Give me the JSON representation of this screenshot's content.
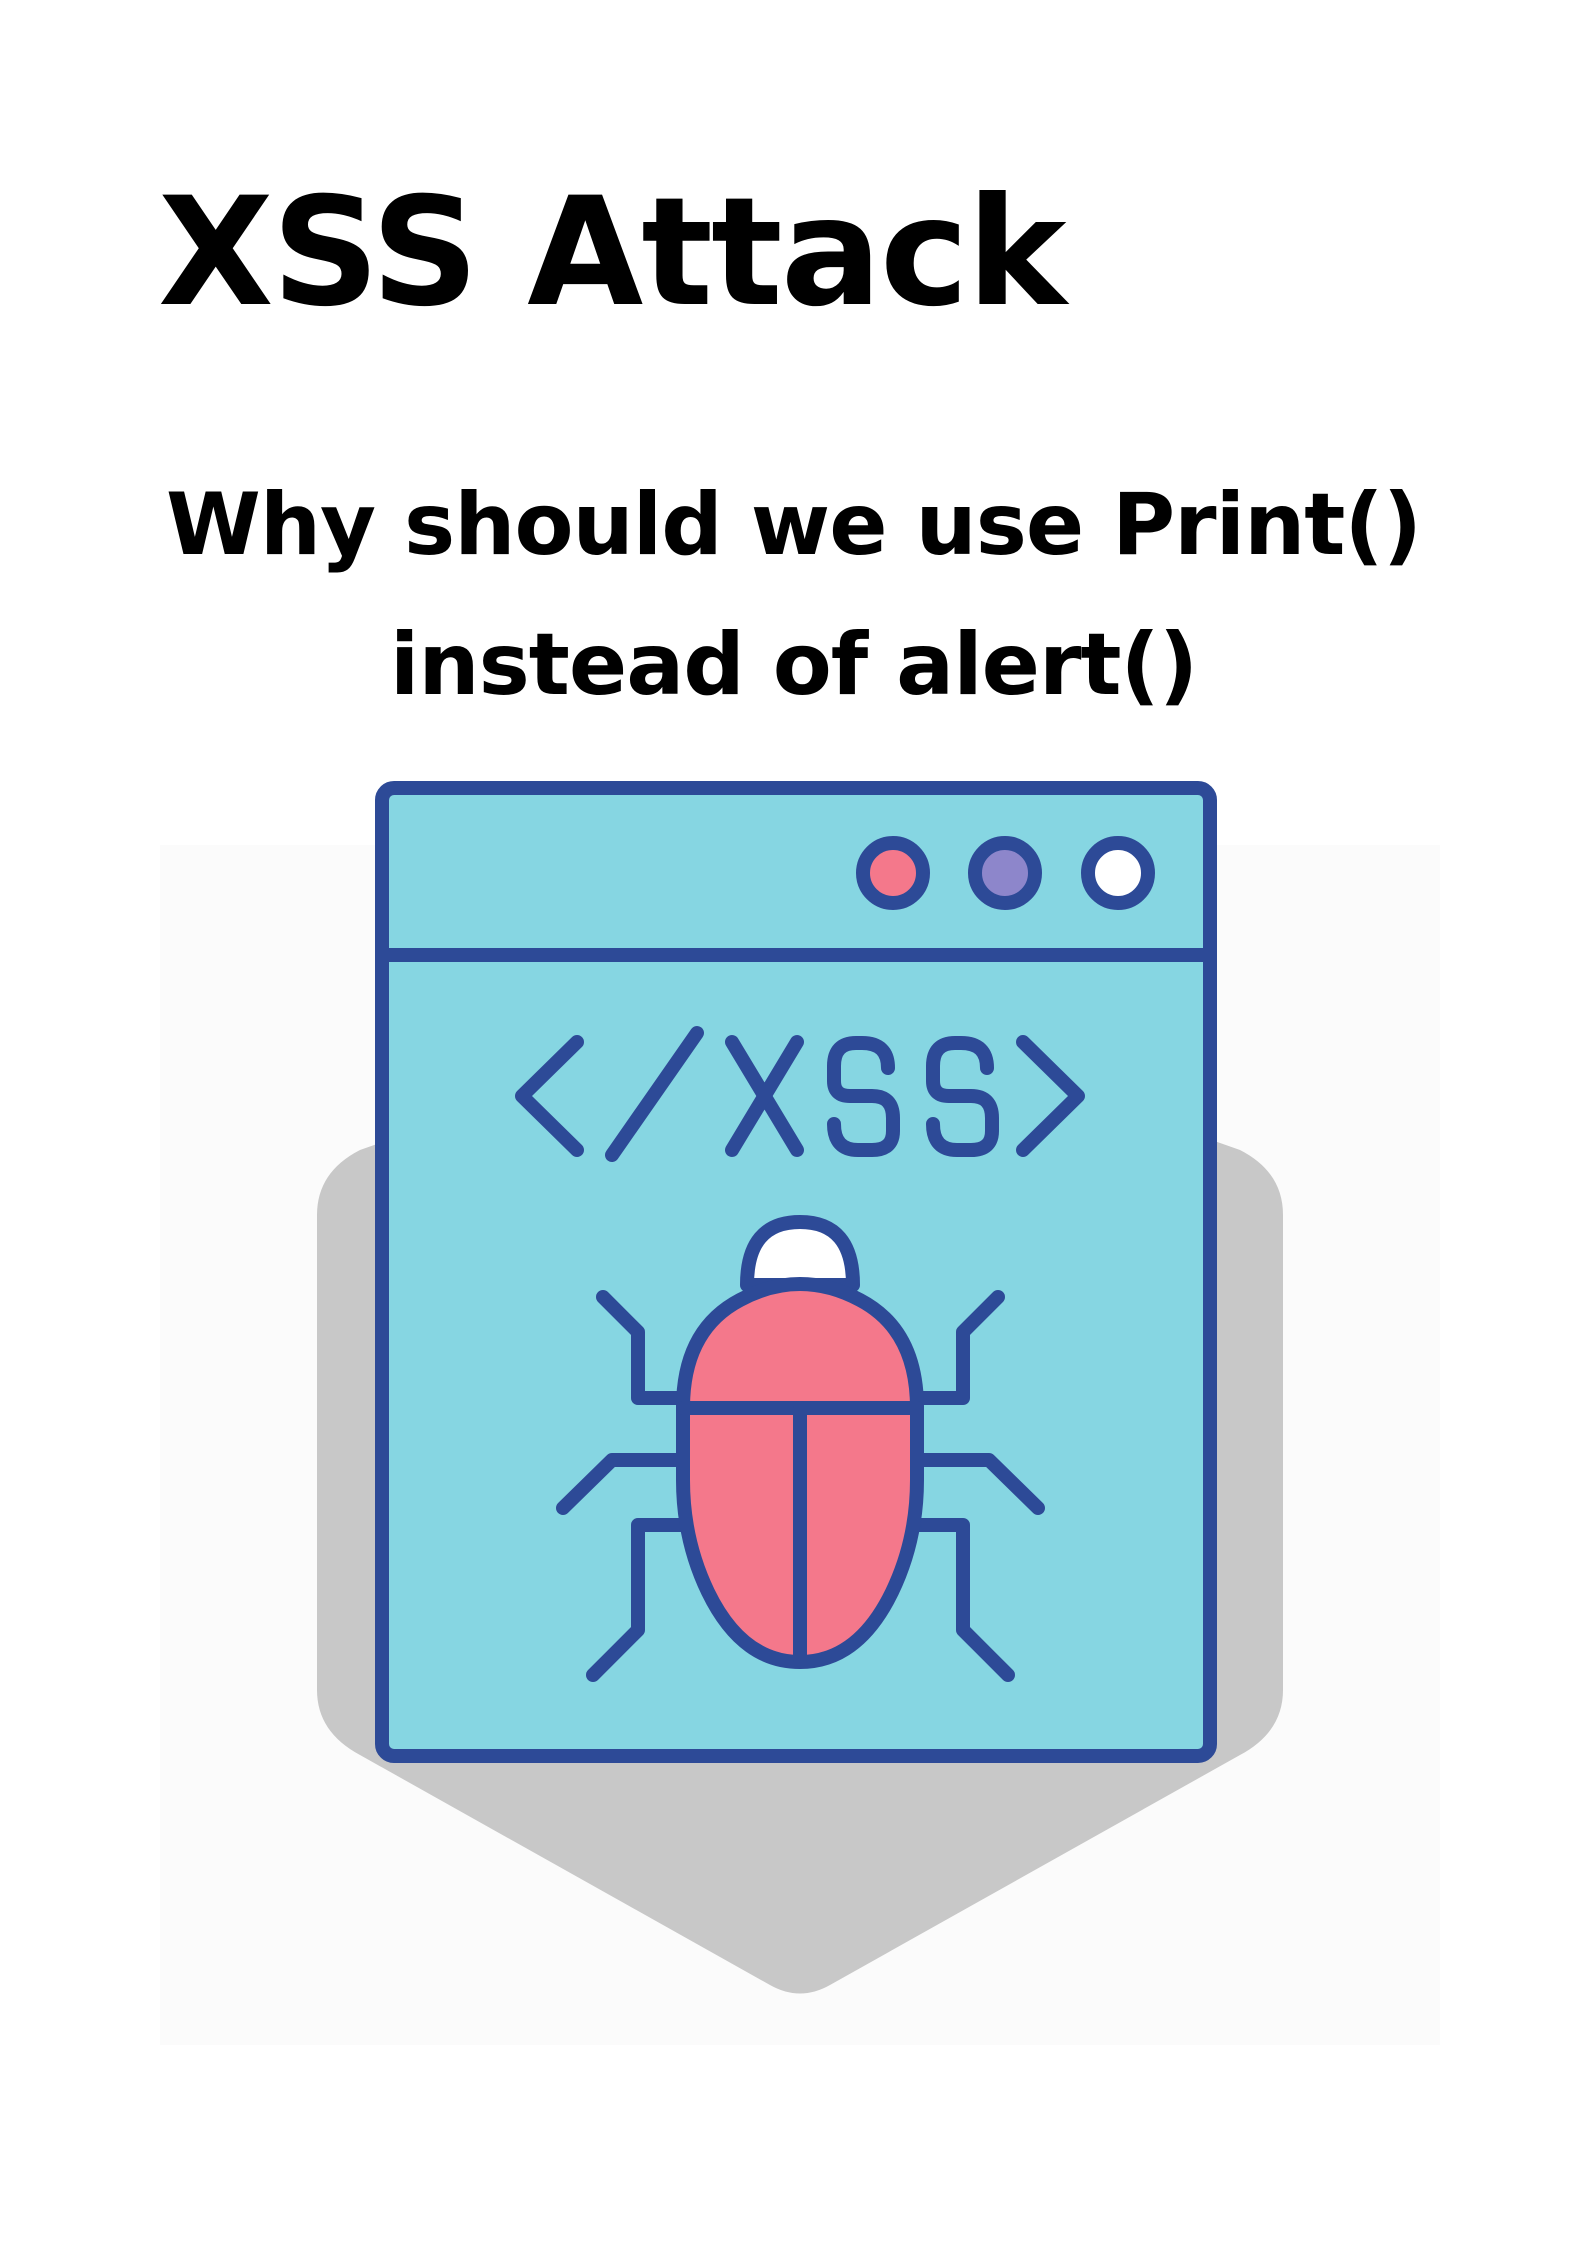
{
  "title": "XSS Attack",
  "subtitle": {
    "line1": "Why should we use Print()",
    "line2": "instead of alert()"
  },
  "illustration": {
    "code_text": "</XSS>",
    "icon": "browser-window-bug-icon",
    "colors": {
      "window_fill": "#86D6E2",
      "outline": "#2D4A97",
      "bug_body": "#F4788B",
      "bug_head": "#FFFFFF",
      "dot_red": "#F4788B",
      "dot_purple": "#8D86CB",
      "dot_white": "#FFFFFF",
      "hexagon_shadow": "#C8C8C8",
      "backdrop": "#FBFBFB"
    }
  }
}
